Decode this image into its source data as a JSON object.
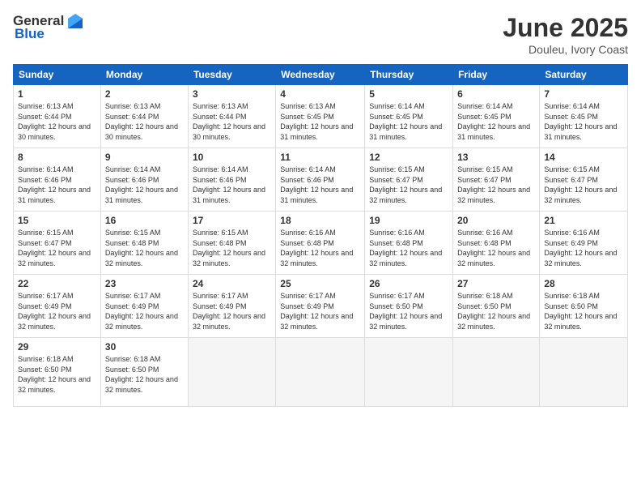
{
  "logo": {
    "general": "General",
    "blue": "Blue"
  },
  "title": "June 2025",
  "subtitle": "Douleu, Ivory Coast",
  "headers": [
    "Sunday",
    "Monday",
    "Tuesday",
    "Wednesday",
    "Thursday",
    "Friday",
    "Saturday"
  ],
  "weeks": [
    [
      {
        "day": "1",
        "sunrise": "6:13 AM",
        "sunset": "6:44 PM",
        "daylight": "12 hours and 30 minutes."
      },
      {
        "day": "2",
        "sunrise": "6:13 AM",
        "sunset": "6:44 PM",
        "daylight": "12 hours and 30 minutes."
      },
      {
        "day": "3",
        "sunrise": "6:13 AM",
        "sunset": "6:44 PM",
        "daylight": "12 hours and 30 minutes."
      },
      {
        "day": "4",
        "sunrise": "6:13 AM",
        "sunset": "6:45 PM",
        "daylight": "12 hours and 31 minutes."
      },
      {
        "day": "5",
        "sunrise": "6:14 AM",
        "sunset": "6:45 PM",
        "daylight": "12 hours and 31 minutes."
      },
      {
        "day": "6",
        "sunrise": "6:14 AM",
        "sunset": "6:45 PM",
        "daylight": "12 hours and 31 minutes."
      },
      {
        "day": "7",
        "sunrise": "6:14 AM",
        "sunset": "6:45 PM",
        "daylight": "12 hours and 31 minutes."
      }
    ],
    [
      {
        "day": "8",
        "sunrise": "6:14 AM",
        "sunset": "6:46 PM",
        "daylight": "12 hours and 31 minutes."
      },
      {
        "day": "9",
        "sunrise": "6:14 AM",
        "sunset": "6:46 PM",
        "daylight": "12 hours and 31 minutes."
      },
      {
        "day": "10",
        "sunrise": "6:14 AM",
        "sunset": "6:46 PM",
        "daylight": "12 hours and 31 minutes."
      },
      {
        "day": "11",
        "sunrise": "6:14 AM",
        "sunset": "6:46 PM",
        "daylight": "12 hours and 31 minutes."
      },
      {
        "day": "12",
        "sunrise": "6:15 AM",
        "sunset": "6:47 PM",
        "daylight": "12 hours and 32 minutes."
      },
      {
        "day": "13",
        "sunrise": "6:15 AM",
        "sunset": "6:47 PM",
        "daylight": "12 hours and 32 minutes."
      },
      {
        "day": "14",
        "sunrise": "6:15 AM",
        "sunset": "6:47 PM",
        "daylight": "12 hours and 32 minutes."
      }
    ],
    [
      {
        "day": "15",
        "sunrise": "6:15 AM",
        "sunset": "6:47 PM",
        "daylight": "12 hours and 32 minutes."
      },
      {
        "day": "16",
        "sunrise": "6:15 AM",
        "sunset": "6:48 PM",
        "daylight": "12 hours and 32 minutes."
      },
      {
        "day": "17",
        "sunrise": "6:15 AM",
        "sunset": "6:48 PM",
        "daylight": "12 hours and 32 minutes."
      },
      {
        "day": "18",
        "sunrise": "6:16 AM",
        "sunset": "6:48 PM",
        "daylight": "12 hours and 32 minutes."
      },
      {
        "day": "19",
        "sunrise": "6:16 AM",
        "sunset": "6:48 PM",
        "daylight": "12 hours and 32 minutes."
      },
      {
        "day": "20",
        "sunrise": "6:16 AM",
        "sunset": "6:48 PM",
        "daylight": "12 hours and 32 minutes."
      },
      {
        "day": "21",
        "sunrise": "6:16 AM",
        "sunset": "6:49 PM",
        "daylight": "12 hours and 32 minutes."
      }
    ],
    [
      {
        "day": "22",
        "sunrise": "6:17 AM",
        "sunset": "6:49 PM",
        "daylight": "12 hours and 32 minutes."
      },
      {
        "day": "23",
        "sunrise": "6:17 AM",
        "sunset": "6:49 PM",
        "daylight": "12 hours and 32 minutes."
      },
      {
        "day": "24",
        "sunrise": "6:17 AM",
        "sunset": "6:49 PM",
        "daylight": "12 hours and 32 minutes."
      },
      {
        "day": "25",
        "sunrise": "6:17 AM",
        "sunset": "6:49 PM",
        "daylight": "12 hours and 32 minutes."
      },
      {
        "day": "26",
        "sunrise": "6:17 AM",
        "sunset": "6:50 PM",
        "daylight": "12 hours and 32 minutes."
      },
      {
        "day": "27",
        "sunrise": "6:18 AM",
        "sunset": "6:50 PM",
        "daylight": "12 hours and 32 minutes."
      },
      {
        "day": "28",
        "sunrise": "6:18 AM",
        "sunset": "6:50 PM",
        "daylight": "12 hours and 32 minutes."
      }
    ],
    [
      {
        "day": "29",
        "sunrise": "6:18 AM",
        "sunset": "6:50 PM",
        "daylight": "12 hours and 32 minutes."
      },
      {
        "day": "30",
        "sunrise": "6:18 AM",
        "sunset": "6:50 PM",
        "daylight": "12 hours and 32 minutes."
      },
      null,
      null,
      null,
      null,
      null
    ]
  ]
}
